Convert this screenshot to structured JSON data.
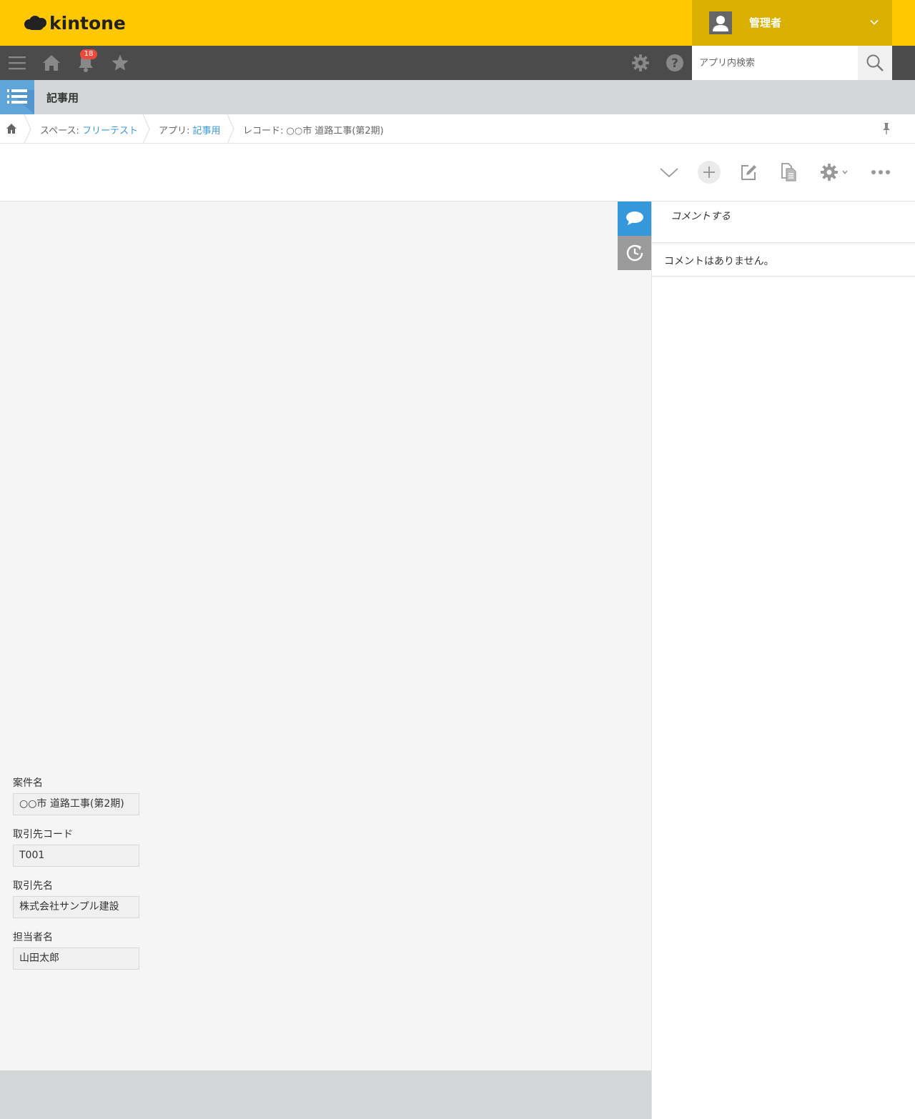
{
  "header": {
    "logo_text": "kintone",
    "user_name": "管理者"
  },
  "nav": {
    "notification_count": "18",
    "search_placeholder": "アプリ内検索"
  },
  "app": {
    "title": "記事用"
  },
  "breadcrumb": {
    "space_prefix": "スペース: ",
    "space_name": "フリーテスト",
    "app_prefix": "アプリ: ",
    "app_name": "記事用",
    "record_label": "レコード: ○○市 道路工事(第2期)"
  },
  "record": {
    "fields": [
      {
        "label": "案件名",
        "value": "○○市 道路工事(第2期)"
      },
      {
        "label": "取引先コード",
        "value": "T001"
      },
      {
        "label": "取引先名",
        "value": "株式会社サンプル建設"
      },
      {
        "label": "担当者名",
        "value": "山田太郎"
      }
    ]
  },
  "comments": {
    "placeholder": "コメントする",
    "empty_text": "コメントはありません。"
  },
  "colors": {
    "header_yellow": "#ffc800",
    "nav_dark": "#4b4b4b",
    "link_blue": "#3498db",
    "badge_red": "#e74c3c"
  }
}
